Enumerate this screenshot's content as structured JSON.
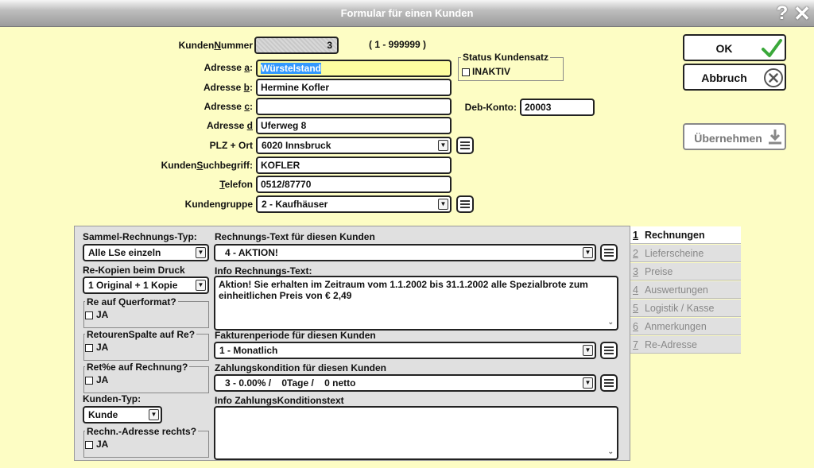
{
  "window": {
    "title": "Formular für einen Kunden",
    "help": "?",
    "close": "✕"
  },
  "header": {
    "kundennummer": {
      "label": "KundenNummer",
      "value": "3",
      "range": "( 1 - 999999 )"
    },
    "adresse_a": {
      "label": "Adresse a:",
      "value": "Würstelstand"
    },
    "adresse_b": {
      "label": "Adresse b:",
      "value": "Hermine Kofler"
    },
    "adresse_c": {
      "label": "Adresse c:",
      "value": ""
    },
    "adresse_d": {
      "label": "Adresse d",
      "value": "Uferweg 8"
    },
    "plz_ort": {
      "label": "PLZ + Ort",
      "value": "6020 Innsbruck"
    },
    "suchbegriff": {
      "label": "KundenSuchbegriff:",
      "value": "KOFLER"
    },
    "telefon": {
      "label": "Telefon",
      "value": "0512/87770"
    },
    "kundengruppe": {
      "label": "Kundengruppe",
      "value": "2 - Kaufhäuser"
    },
    "status": {
      "title": "Status Kundensatz",
      "inaktiv_label": "INAKTIV"
    },
    "deb_konto": {
      "label": "Deb-Konto:",
      "value": "20003"
    }
  },
  "buttons": {
    "ok": "OK",
    "abbruch": "Abbruch",
    "uebernehmen": "Übernehmen"
  },
  "left_panel": {
    "sammel_label": "Sammel-Rechnungs-Typ:",
    "sammel_value": "Alle LSe einzeln",
    "kopien_label": "Re-Kopien beim Druck",
    "kopien_value": "1 Original + 1 Kopie",
    "querformat_title": "Re auf Querformat?",
    "retouren_title": "RetourenSpalte auf Re?",
    "retprozent_title": "Ret%e auf Rechnung?",
    "ja_label": "JA",
    "kundentyp_label": "Kunden-Typ:",
    "kundentyp_value": "Kunde",
    "rechn_adresse_title": "Rechn.-Adresse rechts?"
  },
  "right_panel": {
    "rechnungstext_label": "Rechnungs-Text für diesen Kunden",
    "rechnungstext_value": "4 - AKTION!",
    "info_label": "Info Rechnungs-Text:",
    "info_text": "Aktion! Sie erhalten im Zeitraum vom 1.1.2002 bis 31.1.2002 alle Spezialbrote zum einheitlichen Preis von € 2,49",
    "faktur_label": "Fakturenperiode für diesen Kunden",
    "faktur_value": "1 - Monatlich",
    "zahlung_label": "Zahlungskondition für diesen Kunden",
    "zahlung_value": "3 - 0.00% /    0Tage /    0 netto",
    "info_zahlung_label": "Info ZahlungsKonditionstext",
    "info_zahlung_text": ""
  },
  "tabs": [
    {
      "num": "1",
      "label": "Rechnungen",
      "active": true
    },
    {
      "num": "2",
      "label": "Lieferscheine",
      "active": false
    },
    {
      "num": "3",
      "label": "Preise",
      "active": false
    },
    {
      "num": "4",
      "label": "Auswertungen",
      "active": false
    },
    {
      "num": "5",
      "label": "Logistik / Kasse",
      "active": false
    },
    {
      "num": "6",
      "label": "Anmerkungen",
      "active": false
    },
    {
      "num": "7",
      "label": "Re-Adresse",
      "active": false
    }
  ],
  "icons": {
    "ok": "checkmark-icon",
    "abbruch": "circle-x-icon",
    "uebernehmen": "download-icon",
    "list": "list-icon",
    "dropdown": "chevron-down-icon"
  },
  "colors": {
    "background": "#fdfdc4",
    "highlight": "#fdfda0",
    "selection": "#3399ff",
    "ok_check": "#3aa83a"
  }
}
